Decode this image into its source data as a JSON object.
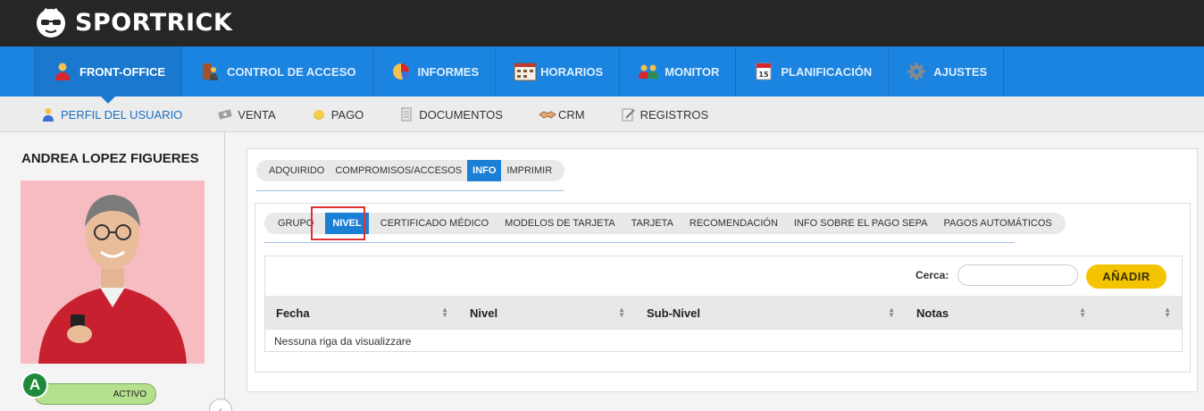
{
  "brand": {
    "name": "SPORTRICK",
    "icon": "sunglasses-face-logo"
  },
  "main_nav": [
    {
      "label": "FRONT-OFFICE",
      "icon": "user-red-icon",
      "active": true
    },
    {
      "label": "CONTROL DE ACCESO",
      "icon": "door-entry-icon",
      "active": false
    },
    {
      "label": "INFORMES",
      "icon": "pie-chart-icon",
      "active": false
    },
    {
      "label": "HORARIOS",
      "icon": "calendar-grid-icon",
      "active": false
    },
    {
      "label": "MONITOR",
      "icon": "group-users-icon",
      "active": false
    },
    {
      "label": "PLANIFICACIÓN",
      "icon": "calendar-15-icon",
      "active": false
    },
    {
      "label": "AJUSTES",
      "icon": "gear-icon",
      "active": false
    }
  ],
  "sub_nav": [
    {
      "label": "PERFIL DEL USUARIO",
      "icon": "user-icon",
      "active": true
    },
    {
      "label": "VENTA",
      "icon": "cash-icon",
      "active": false
    },
    {
      "label": "PAGO",
      "icon": "coins-icon",
      "active": false
    },
    {
      "label": "DOCUMENTOS",
      "icon": "document-icon",
      "active": false
    },
    {
      "label": "CRM",
      "icon": "handshake-icon",
      "active": false
    },
    {
      "label": "REGISTROS",
      "icon": "notepad-icon",
      "active": false
    }
  ],
  "profile": {
    "name": "ANDREA LOPEZ FIGUERES",
    "status_badge": "A",
    "status_label": "ACTIVO"
  },
  "outer_tabs": [
    {
      "label": "ADQUIRIDO",
      "active": false
    },
    {
      "label": "COMPROMISOS/ACCESOS",
      "active": false
    },
    {
      "label": "INFO",
      "active": true
    },
    {
      "label": "IMPRIMIR",
      "active": false
    }
  ],
  "inner_tabs": [
    {
      "label": "GRUPO",
      "active": false
    },
    {
      "label": "NIVEL",
      "active": true
    },
    {
      "label": "CERTIFICADO MÉDICO",
      "active": false
    },
    {
      "label": "MODELOS DE TARJETA",
      "active": false
    },
    {
      "label": "TARJETA",
      "active": false
    },
    {
      "label": "RECOMENDACIÓN",
      "active": false
    },
    {
      "label": "INFO SOBRE EL PAGO SEPA",
      "active": false
    },
    {
      "label": "PAGOS AUTOMÁTICOS",
      "active": false
    }
  ],
  "table": {
    "search_label": "Cerca:",
    "search_value": "",
    "add_label": "AÑADIR",
    "columns": [
      "Fecha",
      "Nivel",
      "Sub-Nivel",
      "Notas",
      ""
    ],
    "empty_message": "Nessuna riga da visualizzare"
  },
  "colors": {
    "brand_bar": "#262626",
    "main_nav": "#1b84e0",
    "active_tab": "#1b7fd6",
    "add_button": "#f5c400",
    "status_green": "#1f8a3b",
    "highlight_red": "#e03131"
  }
}
